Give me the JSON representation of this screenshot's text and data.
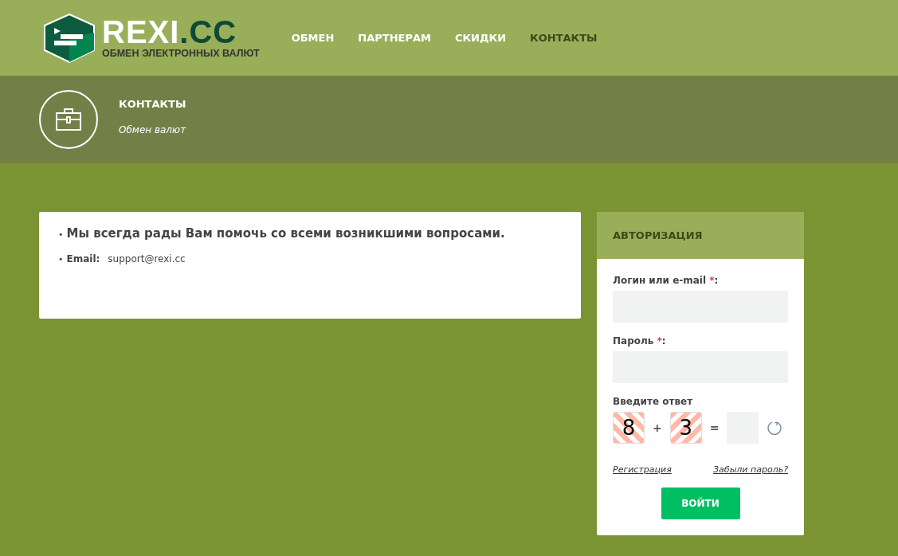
{
  "logo": {
    "name": "REXI",
    "tld": ".CC",
    "tagline": "ОБМЕН ЭЛЕКТРОННЫХ ВАЛЮТ"
  },
  "nav": [
    {
      "label": "ОБМЕН",
      "selected": false
    },
    {
      "label": "ПАРТНЕРАМ",
      "selected": false
    },
    {
      "label": "СКИДКИ",
      "selected": false
    },
    {
      "label": "КОНТАКТЫ",
      "selected": true
    }
  ],
  "page_header": {
    "title": "КОНТАКТЫ",
    "subtitle": "Обмен валют"
  },
  "contacts": {
    "items": [
      {
        "kind": "text",
        "bullet": "•",
        "text": "Мы всегда рады Вам помочь со всеми возникшими вопросами."
      },
      {
        "kind": "email",
        "bullet": "•",
        "label": "Email:",
        "value": "support@rexi.cc"
      }
    ]
  },
  "login": {
    "title": "АВТОРИЗАЦИЯ",
    "fields": [
      {
        "label": "Логин или e-mail",
        "required": "*",
        "suffix": ":"
      },
      {
        "label": "Пароль",
        "required": "*",
        "suffix": ":"
      }
    ],
    "captcha": {
      "label": "Введите ответ",
      "a": "8",
      "op": "+",
      "b": "3",
      "eq": "="
    },
    "register": "Регистрация",
    "forgot": "Забыли пароль?",
    "submit": "ВОЙТИ"
  }
}
